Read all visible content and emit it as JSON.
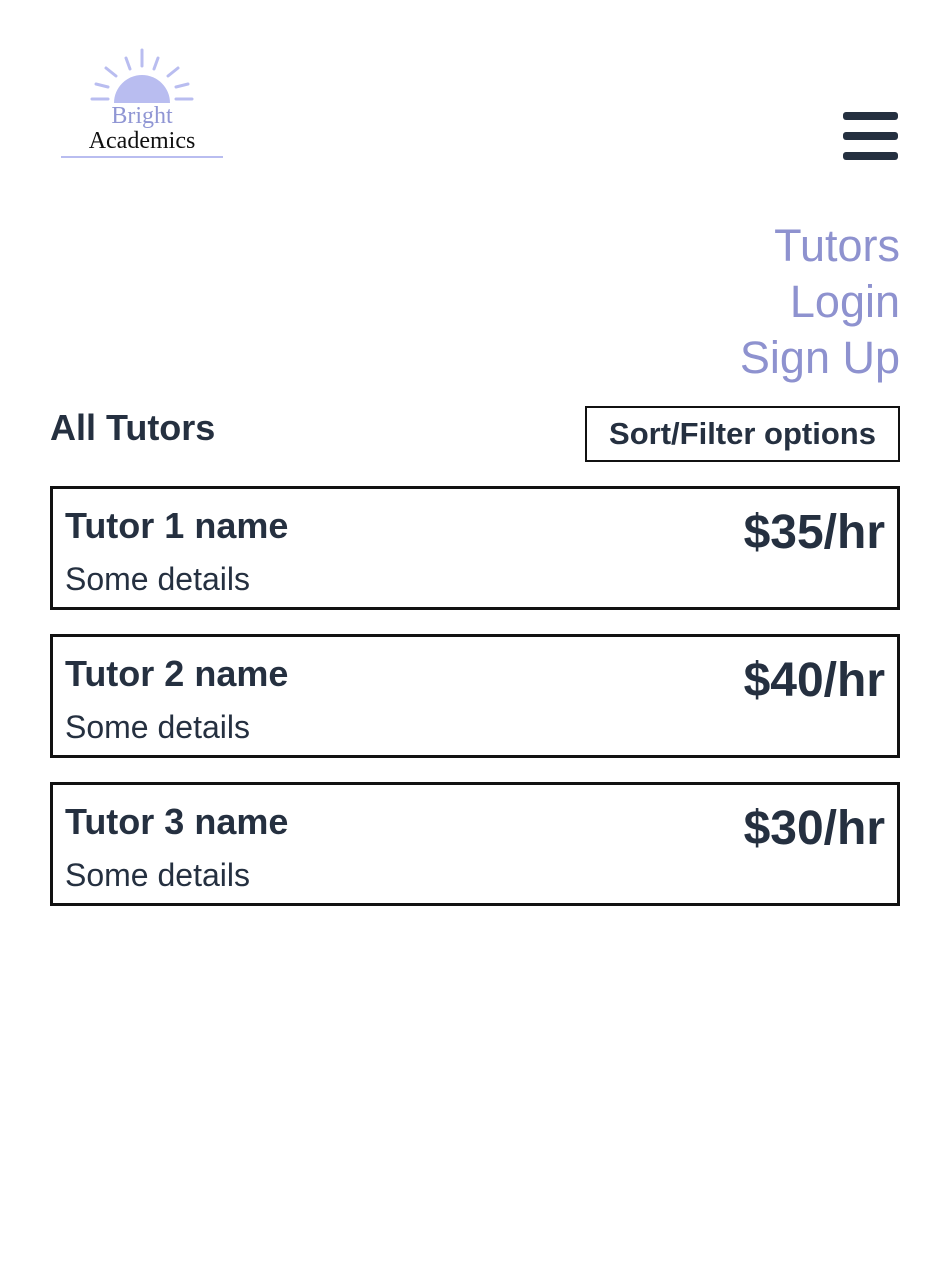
{
  "header": {
    "logo": {
      "line1": "Bright",
      "line2": "Academics",
      "icon": "sunrise-icon"
    },
    "menu_icon": "hamburger-menu-icon"
  },
  "nav": {
    "items": [
      {
        "label": "Tutors"
      },
      {
        "label": "Login"
      },
      {
        "label": "Sign Up"
      }
    ]
  },
  "main": {
    "title": "All Tutors",
    "sort_filter_label": "Sort/Filter options",
    "tutors": [
      {
        "name": "Tutor 1 name",
        "details": "Some details",
        "rate": "$35/hr"
      },
      {
        "name": "Tutor 2 name",
        "details": "Some details",
        "rate": "$40/hr"
      },
      {
        "name": "Tutor 3 name",
        "details": "Some details",
        "rate": "$30/hr"
      }
    ]
  },
  "colors": {
    "text": "#253040",
    "nav_link": "#8e92cf",
    "logo_accent": "#b9bdf0",
    "border": "#111111"
  }
}
